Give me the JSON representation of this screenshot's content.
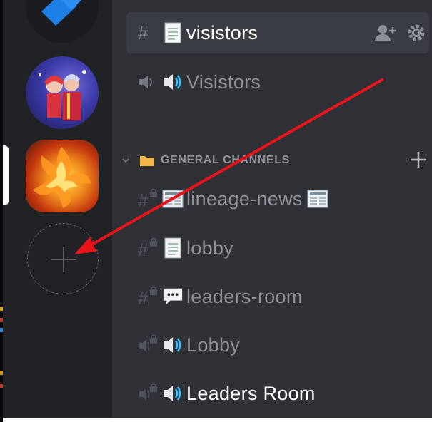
{
  "servers": [
    {
      "name": "server-icon-app"
    },
    {
      "name": "server-icon-christmas"
    },
    {
      "name": "server-icon-phoenix",
      "selected": true
    }
  ],
  "add_server": {
    "icon": "plus-icon"
  },
  "channels_top": [
    {
      "type": "text",
      "emoji": "page-icon",
      "name": "visistors",
      "selected": true
    },
    {
      "type": "voice",
      "emoji": "speaker-icon",
      "name": "Visistors"
    }
  ],
  "category": {
    "name": "GENERAL CHANNELS"
  },
  "channels": [
    {
      "type": "text-locked",
      "emoji": "newspaper-icon",
      "name": "lineage-news",
      "trailing_emoji": "newspaper-icon"
    },
    {
      "type": "text-locked",
      "emoji": "page-icon",
      "name": "lobby"
    },
    {
      "type": "text-locked",
      "emoji": "speech-bubble-icon",
      "name": "leaders-room"
    },
    {
      "type": "voice-locked",
      "emoji": "speaker-icon",
      "name": "Lobby"
    },
    {
      "type": "voice-locked",
      "emoji": "speaker-icon",
      "name": "Leaders Room"
    }
  ],
  "colors": {
    "rail": "#202225",
    "panel": "#2f3136",
    "selected": "#393c43",
    "muted": "#8e9297",
    "arrow": "#e8141b"
  }
}
